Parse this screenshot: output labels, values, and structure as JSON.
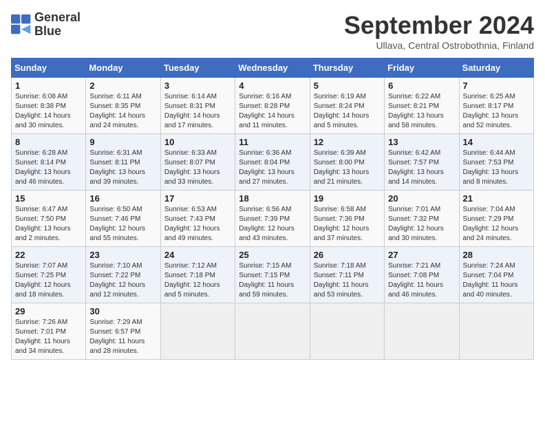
{
  "logo": {
    "line1": "General",
    "line2": "Blue"
  },
  "title": "September 2024",
  "subtitle": "Ullava, Central Ostrobothnia, Finland",
  "headers": [
    "Sunday",
    "Monday",
    "Tuesday",
    "Wednesday",
    "Thursday",
    "Friday",
    "Saturday"
  ],
  "weeks": [
    [
      {
        "day": "1",
        "info": "Sunrise: 6:08 AM\nSunset: 8:38 PM\nDaylight: 14 hours\nand 30 minutes."
      },
      {
        "day": "2",
        "info": "Sunrise: 6:11 AM\nSunset: 8:35 PM\nDaylight: 14 hours\nand 24 minutes."
      },
      {
        "day": "3",
        "info": "Sunrise: 6:14 AM\nSunset: 8:31 PM\nDaylight: 14 hours\nand 17 minutes."
      },
      {
        "day": "4",
        "info": "Sunrise: 6:16 AM\nSunset: 8:28 PM\nDaylight: 14 hours\nand 11 minutes."
      },
      {
        "day": "5",
        "info": "Sunrise: 6:19 AM\nSunset: 8:24 PM\nDaylight: 14 hours\nand 5 minutes."
      },
      {
        "day": "6",
        "info": "Sunrise: 6:22 AM\nSunset: 8:21 PM\nDaylight: 13 hours\nand 58 minutes."
      },
      {
        "day": "7",
        "info": "Sunrise: 6:25 AM\nSunset: 8:17 PM\nDaylight: 13 hours\nand 52 minutes."
      }
    ],
    [
      {
        "day": "8",
        "info": "Sunrise: 6:28 AM\nSunset: 8:14 PM\nDaylight: 13 hours\nand 46 minutes."
      },
      {
        "day": "9",
        "info": "Sunrise: 6:31 AM\nSunset: 8:11 PM\nDaylight: 13 hours\nand 39 minutes."
      },
      {
        "day": "10",
        "info": "Sunrise: 6:33 AM\nSunset: 8:07 PM\nDaylight: 13 hours\nand 33 minutes."
      },
      {
        "day": "11",
        "info": "Sunrise: 6:36 AM\nSunset: 8:04 PM\nDaylight: 13 hours\nand 27 minutes."
      },
      {
        "day": "12",
        "info": "Sunrise: 6:39 AM\nSunset: 8:00 PM\nDaylight: 13 hours\nand 21 minutes."
      },
      {
        "day": "13",
        "info": "Sunrise: 6:42 AM\nSunset: 7:57 PM\nDaylight: 13 hours\nand 14 minutes."
      },
      {
        "day": "14",
        "info": "Sunrise: 6:44 AM\nSunset: 7:53 PM\nDaylight: 13 hours\nand 8 minutes."
      }
    ],
    [
      {
        "day": "15",
        "info": "Sunrise: 6:47 AM\nSunset: 7:50 PM\nDaylight: 13 hours\nand 2 minutes."
      },
      {
        "day": "16",
        "info": "Sunrise: 6:50 AM\nSunset: 7:46 PM\nDaylight: 12 hours\nand 55 minutes."
      },
      {
        "day": "17",
        "info": "Sunrise: 6:53 AM\nSunset: 7:43 PM\nDaylight: 12 hours\nand 49 minutes."
      },
      {
        "day": "18",
        "info": "Sunrise: 6:56 AM\nSunset: 7:39 PM\nDaylight: 12 hours\nand 43 minutes."
      },
      {
        "day": "19",
        "info": "Sunrise: 6:58 AM\nSunset: 7:36 PM\nDaylight: 12 hours\nand 37 minutes."
      },
      {
        "day": "20",
        "info": "Sunrise: 7:01 AM\nSunset: 7:32 PM\nDaylight: 12 hours\nand 30 minutes."
      },
      {
        "day": "21",
        "info": "Sunrise: 7:04 AM\nSunset: 7:29 PM\nDaylight: 12 hours\nand 24 minutes."
      }
    ],
    [
      {
        "day": "22",
        "info": "Sunrise: 7:07 AM\nSunset: 7:25 PM\nDaylight: 12 hours\nand 18 minutes."
      },
      {
        "day": "23",
        "info": "Sunrise: 7:10 AM\nSunset: 7:22 PM\nDaylight: 12 hours\nand 12 minutes."
      },
      {
        "day": "24",
        "info": "Sunrise: 7:12 AM\nSunset: 7:18 PM\nDaylight: 12 hours\nand 5 minutes."
      },
      {
        "day": "25",
        "info": "Sunrise: 7:15 AM\nSunset: 7:15 PM\nDaylight: 11 hours\nand 59 minutes."
      },
      {
        "day": "26",
        "info": "Sunrise: 7:18 AM\nSunset: 7:11 PM\nDaylight: 11 hours\nand 53 minutes."
      },
      {
        "day": "27",
        "info": "Sunrise: 7:21 AM\nSunset: 7:08 PM\nDaylight: 11 hours\nand 46 minutes."
      },
      {
        "day": "28",
        "info": "Sunrise: 7:24 AM\nSunset: 7:04 PM\nDaylight: 11 hours\nand 40 minutes."
      }
    ],
    [
      {
        "day": "29",
        "info": "Sunrise: 7:26 AM\nSunset: 7:01 PM\nDaylight: 11 hours\nand 34 minutes."
      },
      {
        "day": "30",
        "info": "Sunrise: 7:29 AM\nSunset: 6:57 PM\nDaylight: 11 hours\nand 28 minutes."
      },
      {
        "day": "",
        "info": ""
      },
      {
        "day": "",
        "info": ""
      },
      {
        "day": "",
        "info": ""
      },
      {
        "day": "",
        "info": ""
      },
      {
        "day": "",
        "info": ""
      }
    ]
  ]
}
